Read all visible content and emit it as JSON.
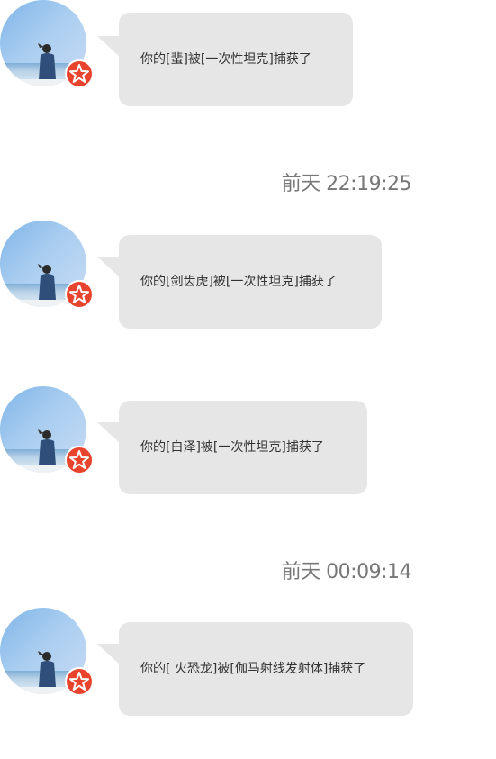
{
  "messages": [
    {
      "text": "你的[蜚]被[一次性坦克]捕获了"
    },
    {
      "text": "你的[剑齿虎]被[一次性坦克]捕获了"
    },
    {
      "text": "你的[白泽]被[一次性坦克]捕获了"
    },
    {
      "text": "你的[ 火恐龙]被[伽马射线发射体]捕获了"
    }
  ],
  "timestamps": [
    {
      "label": "前天 22:19:25"
    },
    {
      "label": "前天 00:09:14"
    }
  ],
  "colors": {
    "bubble": "#e6e6e6",
    "badge": "#e8432d",
    "timestamp_text": "#777777",
    "message_text": "#333333"
  },
  "icons": {
    "avatar": "beach-person-avatar",
    "badge": "red-star-badge-icon"
  }
}
